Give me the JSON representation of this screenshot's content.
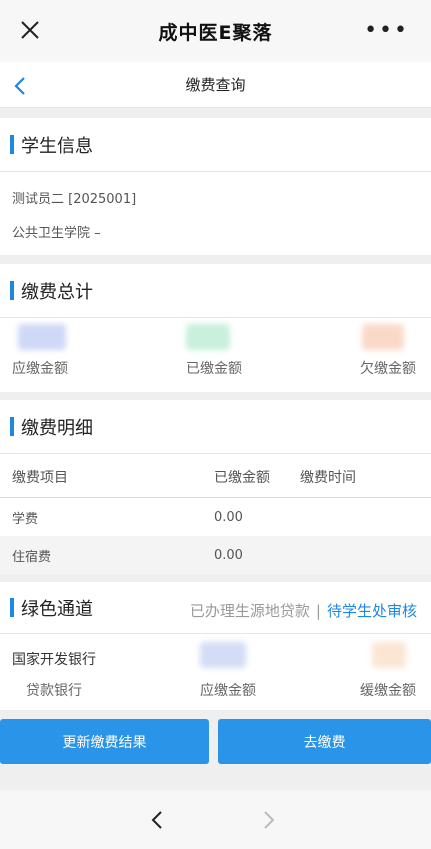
{
  "app": {
    "title": "成中医E聚落"
  },
  "nav": {
    "title": "缴费查询"
  },
  "student": {
    "heading": "学生信息",
    "name_line": "测试员二 [2025001]",
    "school_line": "公共卫生学院 –"
  },
  "summary": {
    "heading": "缴费总计",
    "due_label": "应缴金额",
    "paid_label": "已缴金额",
    "owed_label": "欠缴金额"
  },
  "detail": {
    "heading": "缴费明细",
    "columns": [
      "缴费项目",
      "已缴金额",
      "缴费时间"
    ],
    "rows": [
      {
        "item": "学费",
        "paid": "0.00",
        "time": ""
      },
      {
        "item": "住宿费",
        "paid": "0.00",
        "time": ""
      }
    ]
  },
  "green": {
    "heading": "绿色通道",
    "status_done": "已办理生源地贷款",
    "status_sep": "|",
    "status_pending": "待学生处审核",
    "bank_name": "国家开发银行",
    "loan_bank_label": "贷款银行",
    "due_label": "应缴金额",
    "deferred_label": "缓缴金额"
  },
  "buttons": {
    "refresh": "更新缴费结果",
    "pay": "去缴费"
  },
  "colors": {
    "accent": "#1d87e4",
    "button": "#2a95e8"
  }
}
